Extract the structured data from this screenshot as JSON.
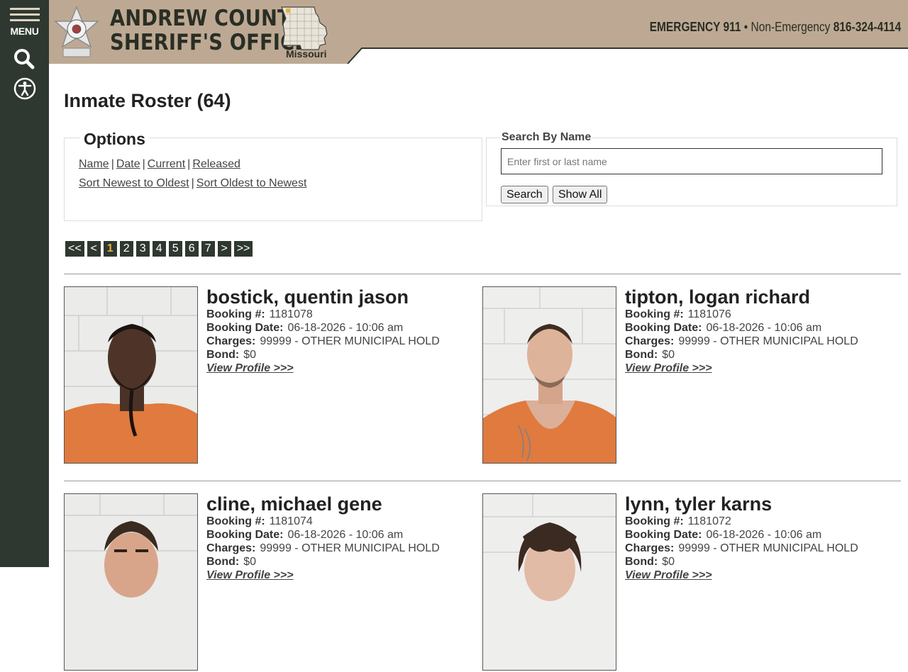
{
  "sidebar": {
    "menu_label": "MENU"
  },
  "header": {
    "title_line1": "ANDREW COUNTY",
    "title_line2": "SHERIFF'S OFFICE",
    "map_label": "Missouri",
    "emergency_label": "EMERGENCY 911",
    "separator": "•",
    "nonemergency_label": "Non-Emergency",
    "nonemergency_number": "816-324-4114",
    "colors": {
      "band": "#bda993",
      "rail": "#2f3830",
      "accent": "#e7b23a"
    }
  },
  "page": {
    "title": "Inmate Roster (64)"
  },
  "options": {
    "legend": "Options",
    "row1": [
      "Name",
      "Date",
      "Current",
      "Released"
    ],
    "row2": [
      "Sort Newest to Oldest",
      "Sort Oldest to Newest"
    ],
    "sep": "|"
  },
  "search": {
    "legend": "Search By Name",
    "placeholder": "Enter first or last name",
    "search_label": "Search",
    "show_all_label": "Show All"
  },
  "pagination": {
    "first": "<<",
    "prev": "<",
    "pages": [
      "1",
      "2",
      "3",
      "4",
      "5",
      "6",
      "7"
    ],
    "current": "1",
    "next": ">",
    "last": ">>"
  },
  "labels": {
    "booking": "Booking #:",
    "date": "Booking Date:",
    "charges": "Charges:",
    "bond": "Bond:",
    "profile": "View Profile >>>"
  },
  "inmates": [
    {
      "name": "bostick, quentin jason",
      "booking": "1181078",
      "date": "06-18-2026 - 10:06 am",
      "charges": "99999 - OTHER MUNICIPAL HOLD",
      "bond": "$0"
    },
    {
      "name": "tipton, logan richard",
      "booking": "1181076",
      "date": "06-18-2026 - 10:06 am",
      "charges": "99999 - OTHER MUNICIPAL HOLD",
      "bond": "$0"
    },
    {
      "name": "cline, michael gene",
      "booking": "1181074",
      "date": "06-18-2026 - 10:06 am",
      "charges": "99999 - OTHER MUNICIPAL HOLD",
      "bond": "$0"
    },
    {
      "name": "lynn, tyler karns",
      "booking": "1181072",
      "date": "06-18-2026 - 10:06 am",
      "charges": "99999 - OTHER MUNICIPAL HOLD",
      "bond": "$0"
    }
  ]
}
